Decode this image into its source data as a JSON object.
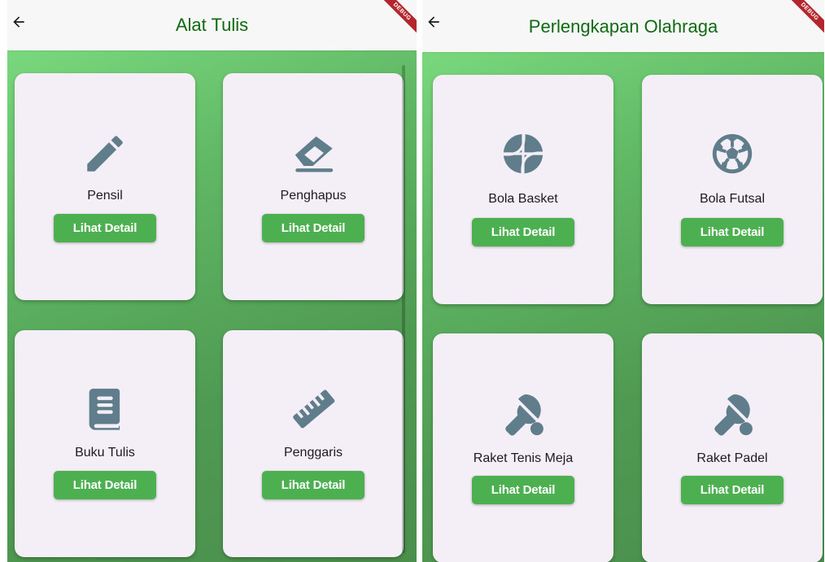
{
  "colors": {
    "title": "#0f6a12",
    "button": "#4caf50",
    "icon": "#607d8b",
    "card": "#f4eff7",
    "ribbon": "#b3262e"
  },
  "debug_label": "DEBUG",
  "left_screen": {
    "title": "Alat Tulis",
    "back_icon": "arrow-back-icon",
    "items": [
      {
        "label": "Pensil",
        "button": "Lihat Detail",
        "icon": "pencil-icon"
      },
      {
        "label": "Penghapus",
        "button": "Lihat Detail",
        "icon": "eraser-icon"
      },
      {
        "label": "Buku Tulis",
        "button": "Lihat Detail",
        "icon": "book-icon"
      },
      {
        "label": "Penggaris",
        "button": "Lihat Detail",
        "icon": "ruler-icon"
      }
    ]
  },
  "right_screen": {
    "title": "Perlengkapan Olahraga",
    "back_icon": "arrow-back-icon",
    "items": [
      {
        "label": "Bola Basket",
        "button": "Lihat Detail",
        "icon": "basketball-icon"
      },
      {
        "label": "Bola Futsal",
        "button": "Lihat Detail",
        "icon": "soccer-ball-icon"
      },
      {
        "label": "Raket Tenis Meja",
        "button": "Lihat Detail",
        "icon": "table-tennis-icon"
      },
      {
        "label": "Raket Padel",
        "button": "Lihat Detail",
        "icon": "table-tennis-icon"
      }
    ]
  }
}
